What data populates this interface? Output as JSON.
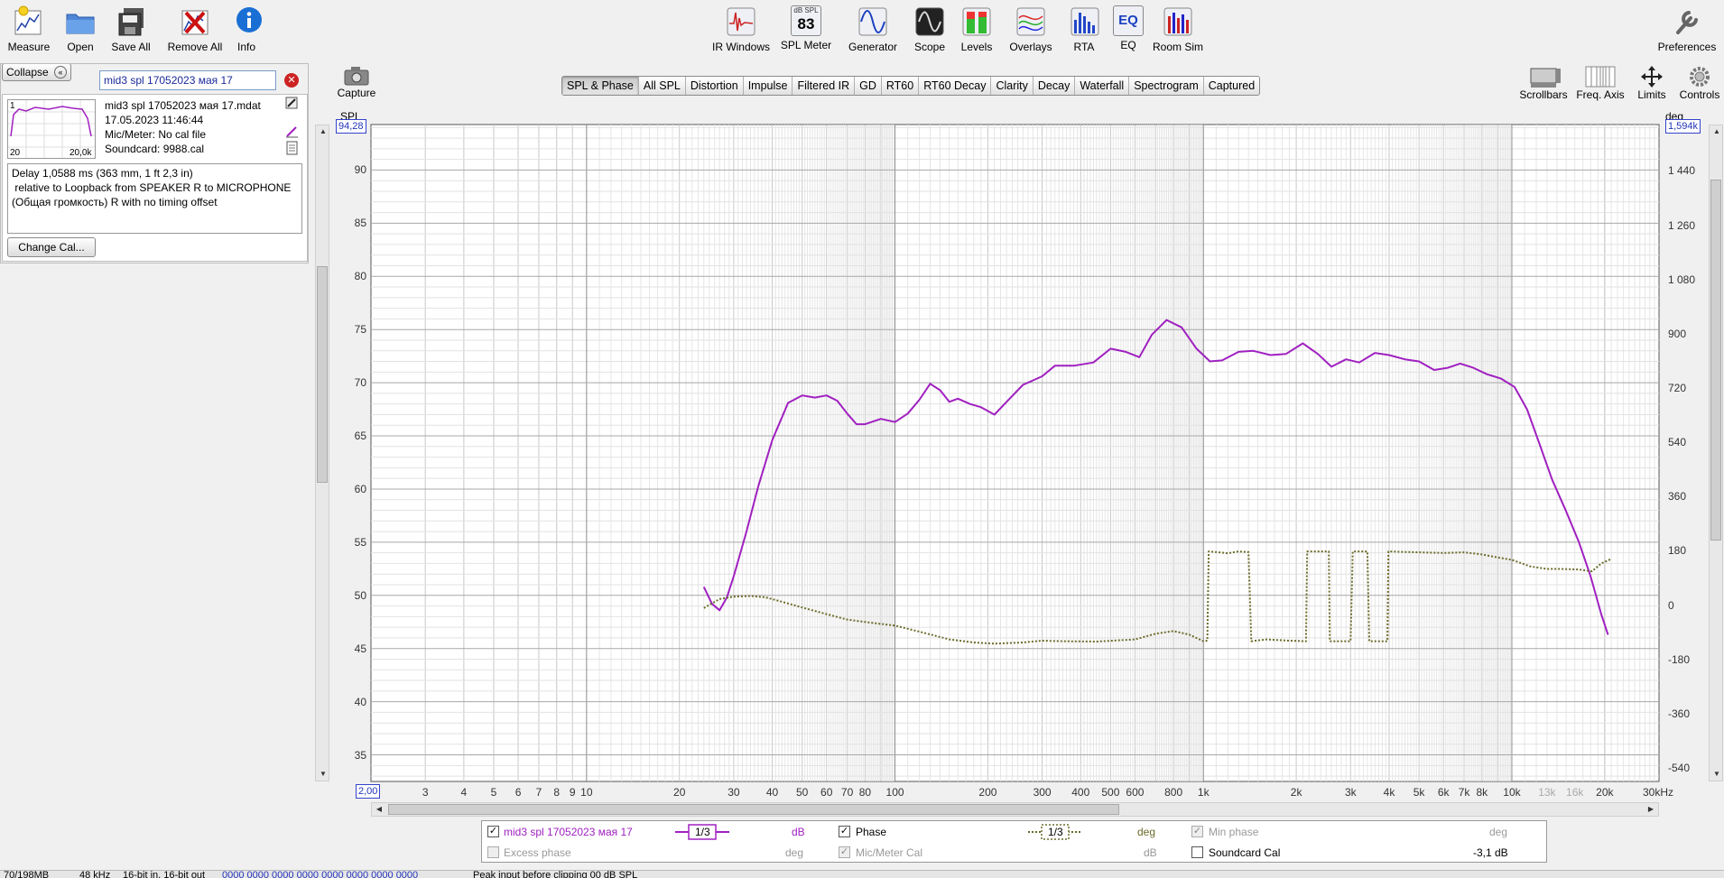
{
  "toolbar": {
    "left": [
      {
        "label": "Measure",
        "icon": "measure-icon"
      },
      {
        "label": "Open",
        "icon": "folder-icon"
      },
      {
        "label": "Save All",
        "icon": "save-icon"
      },
      {
        "label": "Remove All",
        "icon": "remove-icon"
      },
      {
        "label": "Info",
        "icon": "info-icon"
      }
    ],
    "center": [
      {
        "label": "IR Windows",
        "icon": "ir-windows-icon"
      },
      {
        "label": "SPL Meter",
        "icon": "spl-meter-icon",
        "badge_top": "dB SPL",
        "badge_value": "83"
      },
      {
        "label": "Generator",
        "icon": "generator-icon"
      },
      {
        "label": "Scope",
        "icon": "scope-icon"
      },
      {
        "label": "Levels",
        "icon": "levels-icon"
      },
      {
        "label": "Overlays",
        "icon": "overlays-icon"
      },
      {
        "label": "RTA",
        "icon": "rta-icon"
      },
      {
        "label": "EQ",
        "icon": "eq-icon",
        "badge_value": "EQ"
      },
      {
        "label": "Room Sim",
        "icon": "room-sim-icon"
      }
    ],
    "preferences": "Preferences"
  },
  "left_panel": {
    "collapse": "Collapse",
    "name": "mid3 spl 17052023 мая 17",
    "file": "mid3 spl 17052023 мая 17.mdat",
    "datetime": "17.05.2023 11:46:44",
    "mic": "Mic/Meter: No cal file",
    "soundcard": "Soundcard: 9988.cal",
    "thumb_left": "20",
    "thumb_right": "20,0k",
    "thumb_top": "1",
    "notes": [
      "Delay 1,0588 ms (363 mm, 1 ft 2,3 in)",
      " relative to Loopback from SPEAKER R to MICROPHONE",
      "(Общая громкость) R with no timing offset"
    ],
    "change_cal": "Change Cal..."
  },
  "capture": {
    "label": "Capture",
    "icon": "camera-icon"
  },
  "tabs": [
    "SPL & Phase",
    "All SPL",
    "Distortion",
    "Impulse",
    "Filtered IR",
    "GD",
    "RT60",
    "RT60 Decay",
    "Clarity",
    "Decay",
    "Waterfall",
    "Spectrogram",
    "Captured"
  ],
  "active_tab": "SPL & Phase",
  "right_tools": [
    {
      "label": "Scrollbars",
      "icon": "scrollbars-icon"
    },
    {
      "label": "Freq. Axis",
      "icon": "freq-axis-icon"
    },
    {
      "label": "Limits",
      "icon": "limits-icon"
    },
    {
      "label": "Controls",
      "icon": "controls-icon"
    }
  ],
  "axis": {
    "left_title": "SPL",
    "right_title": "deg",
    "left_top_value": "94,28",
    "right_top_value": "1,594k",
    "x_start_value": "2,00",
    "x_end_label": "30kHz"
  },
  "chart_data": {
    "type": "line",
    "x_scale": "log",
    "xlim": [
      2,
      30000
    ],
    "ylim_left": [
      32.5,
      94.28
    ],
    "ylim_right": [
      -585,
      1594
    ],
    "y_ticks_left": [
      "90",
      "85",
      "80",
      "75",
      "70",
      "65",
      "60",
      "55",
      "50",
      "45",
      "40",
      "35"
    ],
    "y_ticks_right": [
      "1 440",
      "1 260",
      "1 080",
      "900",
      "720",
      "540",
      "360",
      "180",
      "0",
      "-180",
      "-360",
      "-540"
    ],
    "x_ticks": [
      "3",
      "4",
      "5",
      "6",
      "7",
      "8",
      "9",
      "10",
      "20",
      "30",
      "40",
      "50",
      "60",
      "70",
      "80",
      "100",
      "200",
      "300",
      "400",
      "500",
      "600",
      "800",
      "1k",
      "2k",
      "3k",
      "4k",
      "5k",
      "6k",
      "7k",
      "8k",
      "10k",
      "13k",
      "16k",
      "20k"
    ],
    "x_ticks_dim": [
      "13k",
      "16k"
    ],
    "series": [
      {
        "name": "mid3 spl 17052023 мая 17",
        "axis": "left",
        "color": "#a020c0",
        "points": [
          [
            24,
            50.8
          ],
          [
            25.5,
            49.2
          ],
          [
            27,
            48.6
          ],
          [
            28.5,
            49.8
          ],
          [
            30,
            51.8
          ],
          [
            33,
            56
          ],
          [
            36,
            60.2
          ],
          [
            40,
            64.6
          ],
          [
            45,
            68.1
          ],
          [
            50,
            68.8
          ],
          [
            55,
            68.6
          ],
          [
            60,
            68.8
          ],
          [
            65,
            68.3
          ],
          [
            70,
            67.1
          ],
          [
            75,
            66.1
          ],
          [
            80,
            66.1
          ],
          [
            90,
            66.6
          ],
          [
            100,
            66.3
          ],
          [
            110,
            67.1
          ],
          [
            120,
            68.4
          ],
          [
            130,
            69.9
          ],
          [
            140,
            69.3
          ],
          [
            150,
            68.2
          ],
          [
            160,
            68.5
          ],
          [
            175,
            68.0
          ],
          [
            190,
            67.7
          ],
          [
            210,
            67.0
          ],
          [
            230,
            68.2
          ],
          [
            260,
            69.8
          ],
          [
            300,
            70.6
          ],
          [
            330,
            71.6
          ],
          [
            380,
            71.6
          ],
          [
            440,
            71.9
          ],
          [
            500,
            73.2
          ],
          [
            560,
            72.9
          ],
          [
            620,
            72.4
          ],
          [
            680,
            74.5
          ],
          [
            760,
            75.9
          ],
          [
            850,
            75.2
          ],
          [
            950,
            73.2
          ],
          [
            1050,
            72.0
          ],
          [
            1150,
            72.1
          ],
          [
            1300,
            72.9
          ],
          [
            1450,
            73.0
          ],
          [
            1650,
            72.6
          ],
          [
            1850,
            72.7
          ],
          [
            2100,
            73.7
          ],
          [
            2350,
            72.7
          ],
          [
            2600,
            71.5
          ],
          [
            2900,
            72.2
          ],
          [
            3200,
            71.9
          ],
          [
            3600,
            72.8
          ],
          [
            4000,
            72.6
          ],
          [
            4500,
            72.2
          ],
          [
            5000,
            72.0
          ],
          [
            5600,
            71.2
          ],
          [
            6200,
            71.4
          ],
          [
            6800,
            71.8
          ],
          [
            7500,
            71.4
          ],
          [
            8300,
            70.8
          ],
          [
            9200,
            70.4
          ],
          [
            10200,
            69.6
          ],
          [
            11200,
            67.5
          ],
          [
            12200,
            64.5
          ],
          [
            13500,
            60.9
          ],
          [
            15000,
            57.9
          ],
          [
            16500,
            55.0
          ],
          [
            18000,
            51.8
          ],
          [
            19500,
            48.2
          ],
          [
            20500,
            46.3
          ]
        ]
      },
      {
        "name": "Phase",
        "axis": "right",
        "color": "#6b6b2a",
        "points": [
          [
            24,
            -10
          ],
          [
            27,
            20
          ],
          [
            30,
            28
          ],
          [
            34,
            30
          ],
          [
            38,
            26
          ],
          [
            42,
            14
          ],
          [
            50,
            -8
          ],
          [
            60,
            -30
          ],
          [
            70,
            -48
          ],
          [
            80,
            -56
          ],
          [
            100,
            -68
          ],
          [
            120,
            -88
          ],
          [
            150,
            -114
          ],
          [
            180,
            -124
          ],
          [
            210,
            -128
          ],
          [
            260,
            -124
          ],
          [
            300,
            -118
          ],
          [
            350,
            -120
          ],
          [
            450,
            -121
          ],
          [
            600,
            -114
          ],
          [
            700,
            -95
          ],
          [
            800,
            -86
          ],
          [
            900,
            -98
          ],
          [
            1000,
            -120
          ],
          [
            1030,
            -118
          ],
          [
            1040,
            178
          ],
          [
            1100,
            176
          ],
          [
            1200,
            172
          ],
          [
            1300,
            178
          ],
          [
            1400,
            176
          ],
          [
            1430,
            -120
          ],
          [
            1600,
            -114
          ],
          [
            1900,
            -118
          ],
          [
            2150,
            -120
          ],
          [
            2170,
            178
          ],
          [
            2400,
            178
          ],
          [
            2550,
            178
          ],
          [
            2570,
            -120
          ],
          [
            3000,
            -120
          ],
          [
            3050,
            178
          ],
          [
            3400,
            178
          ],
          [
            3450,
            -120
          ],
          [
            3950,
            -120
          ],
          [
            3980,
            178
          ],
          [
            5000,
            175
          ],
          [
            6000,
            173
          ],
          [
            7000,
            175
          ],
          [
            8000,
            168
          ],
          [
            9000,
            158
          ],
          [
            10000,
            150
          ],
          [
            11500,
            128
          ],
          [
            13000,
            120
          ],
          [
            14500,
            120
          ],
          [
            16500,
            118
          ],
          [
            18200,
            112
          ],
          [
            19500,
            138
          ],
          [
            21000,
            153
          ]
        ]
      }
    ]
  },
  "legend": {
    "row1": {
      "meas_name": "mid3 spl 17052023 мая 17",
      "smoothing": "1/3",
      "unit": "dB",
      "phase_label": "Phase",
      "phase_smoothing": "1/3",
      "phase_unit": "deg",
      "min_phase_label": "Min phase",
      "min_phase_unit": "deg"
    },
    "row2": {
      "excess_phase_label": "Excess phase",
      "excess_phase_unit": "deg",
      "mic_meter_cal_label": "Mic/Meter Cal",
      "mic_meter_cal_unit": "dB",
      "soundcard_cal_label": "Soundcard Cal",
      "soundcard_cal_value": "-3,1 dB"
    }
  },
  "statusbar": {
    "items": [
      "70/198MB",
      "48 kHz",
      "16-bit in, 16-bit out",
      "0000 0000 0000 0000 0000 0000 0000 0000",
      "Peak input before clipping 00 dB SPL"
    ]
  }
}
